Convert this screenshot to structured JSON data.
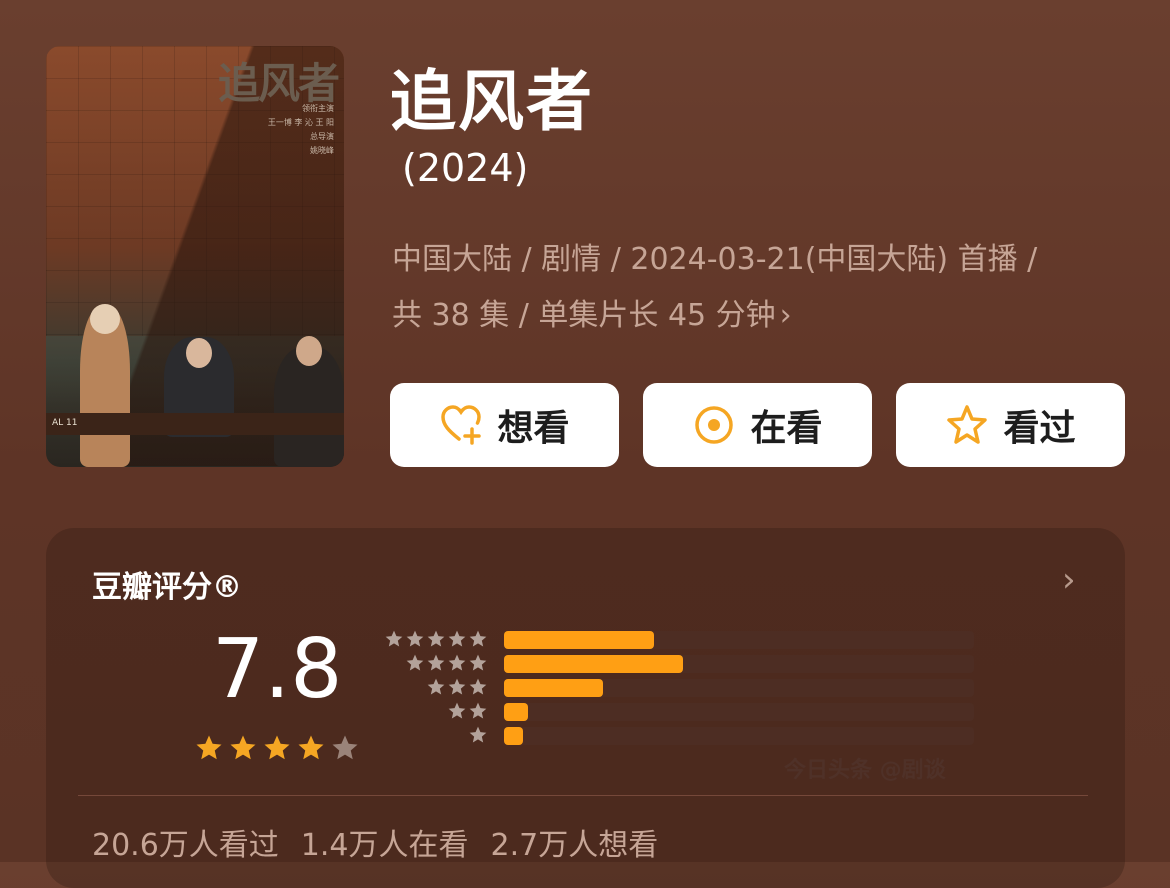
{
  "poster": {
    "title_art": "追风者",
    "credits": [
      "领衔主演",
      "王一博 李 沁 王 阳",
      "总导演",
      "姚晓峰"
    ],
    "sign_left": "AL 11"
  },
  "title": "追风者",
  "year": "(2024)",
  "meta": {
    "line1": "中国大陆 / 剧情 / 2024-03-21(中国大陆) 首播 /",
    "line2": "共 38 集 / 单集片长 45 分钟"
  },
  "buttons": {
    "want": "想看",
    "watching": "在看",
    "watched": "看过"
  },
  "rating": {
    "label": "豆瓣评分®",
    "score": "7.8",
    "stars_filled": 4,
    "stars_total": 5,
    "distribution": [
      {
        "stars": 5,
        "percent": 32
      },
      {
        "stars": 4,
        "percent": 38
      },
      {
        "stars": 3,
        "percent": 21
      },
      {
        "stars": 2,
        "percent": 5
      },
      {
        "stars": 1,
        "percent": 4
      }
    ],
    "watermark": "今日头条 @剧谈"
  },
  "counts": {
    "watched": "20.6万人看过",
    "watching": "1.4万人在看",
    "want": "2.7万人想看"
  },
  "colors": {
    "accent": "#ff9f14",
    "star": "#f5a623",
    "button_bg": "#ffffff",
    "bar_track": "#4d2d23"
  }
}
